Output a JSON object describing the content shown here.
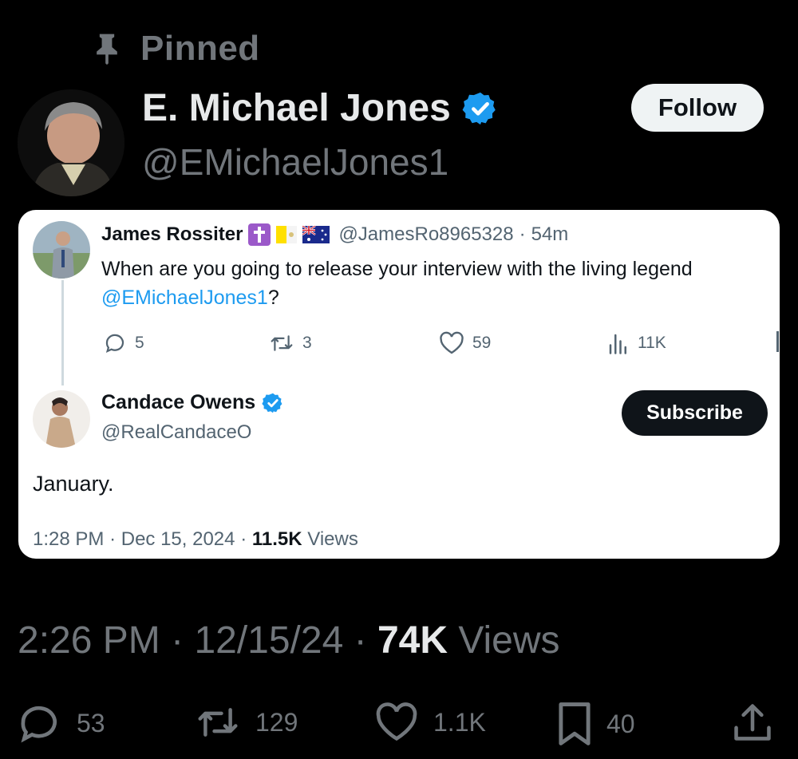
{
  "pinned": {
    "label": "Pinned"
  },
  "author": {
    "name": "E. Michael Jones",
    "handle": "@EMichaelJones1",
    "follow_label": "Follow"
  },
  "reply": {
    "name": "James Rossiter",
    "handle": "@JamesRo8965328",
    "time": "54m",
    "text_before": "When are you going to release your interview with the living legend ",
    "mention": "@EMichaelJones1",
    "text_after": "?",
    "stats": {
      "replies": "5",
      "reposts": "3",
      "likes": "59",
      "views": "11K"
    }
  },
  "quoted": {
    "name": "Candace Owens",
    "handle": "@RealCandaceO",
    "subscribe_label": "Subscribe",
    "text": "January.",
    "time": "1:28 PM",
    "date": "Dec 15, 2024",
    "views_count": "11.5K",
    "views_label": "Views"
  },
  "post": {
    "time": "2:26 PM",
    "date": "12/15/24",
    "views_count": "74K",
    "views_label": "Views",
    "stats": {
      "replies": "53",
      "reposts": "129",
      "likes": "1.1K",
      "bookmarks": "40"
    }
  },
  "colors": {
    "verified": "#1d9bf0",
    "link": "#1d9bf0",
    "muted_dark": "#71767b",
    "muted_light": "#536471"
  },
  "icons": [
    "pin-icon",
    "verified-badge-icon",
    "cross-flag-icon",
    "vatican-flag-icon",
    "australia-flag-icon",
    "reply-icon",
    "repost-icon",
    "like-icon",
    "views-icon",
    "bookmark-icon",
    "share-icon"
  ]
}
